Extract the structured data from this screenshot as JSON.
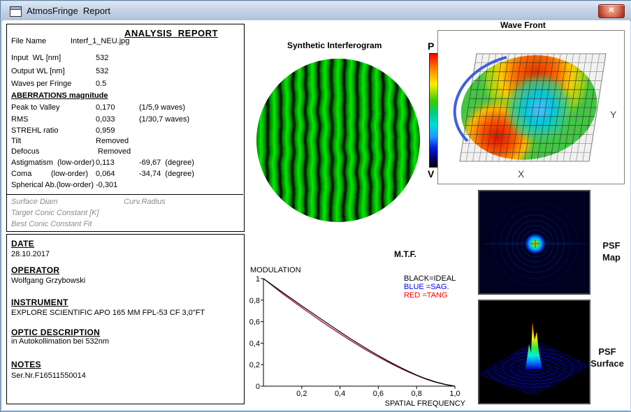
{
  "window": {
    "title": "AtmosFringe  Report",
    "close_glyph": "✕"
  },
  "report": {
    "title": "ANALYSIS  REPORT",
    "rows": [
      {
        "label": "File Name",
        "value": "Interf_1_NEU.jpg"
      },
      {
        "label": "Input  WL [nm]",
        "value": "532"
      },
      {
        "label": "Output WL [nm]",
        "value": "532"
      },
      {
        "label": "Waves per Fringe",
        "value": "0.5"
      }
    ],
    "aberrations_heading": "ABERRATIONS magnitude",
    "aberration_rows": [
      {
        "label": "Peak to Valley",
        "value": "0,170",
        "extra": "(1/5,9 waves)"
      },
      {
        "label": "RMS",
        "value": "0,033",
        "extra": "(1/30,7 waves)"
      },
      {
        "label": "STREHL ratio",
        "value": "0,959",
        "extra": ""
      },
      {
        "label": "Tilt",
        "value": "Removed",
        "extra": ""
      },
      {
        "label": "Defocus",
        "value": " Removed",
        "extra": ""
      },
      {
        "label": "Astigmatism  (low-order)",
        "value": "0,113",
        "extra": "-69,67  (degree)"
      },
      {
        "label": "Coma         (low-order)",
        "value": "0,064",
        "extra": "-34,74  (degree)"
      },
      {
        "label": "Spherical Ab.(low-order)",
        "value": "-0,301",
        "extra": ""
      }
    ],
    "conic": {
      "line1a": "Surface Diam",
      "line1b": "Curv.Radius",
      "line2": "Target Conic Constant [K]",
      "line3": "Best Conic Constant Fit"
    }
  },
  "info": {
    "sections": [
      {
        "heading": "DATE",
        "text": "28.10.2017"
      },
      {
        "heading": "OPERATOR",
        "text": "Wolfgang Grzybowski"
      },
      {
        "heading": "INSTRUMENT",
        "text": "EXPLORE SCIENTIFIC APO 165 MM FPL-53 CF 3,0\"FT"
      },
      {
        "heading": "OPTIC DESCRIPTION",
        "text": "in Autokollimation bei 532nm"
      },
      {
        "heading": "NOTES",
        "text": "Ser.Nr.F16511550014"
      }
    ]
  },
  "interferogram": {
    "title": "Synthetic Interferogram",
    "fringe_color": "#00ee00"
  },
  "wavefront": {
    "title": "Wave Front",
    "colorbar_top": "P",
    "colorbar_bottom": "V",
    "x_label": "X",
    "y_label": "Y"
  },
  "psf": {
    "map_label_line1": "PSF",
    "map_label_line2": "Map",
    "surface_label_line1": "PSF",
    "surface_label_line2": "Surface"
  },
  "mtf": {
    "legend": [
      {
        "text": "BLACK=IDEAL",
        "color": "#000000"
      },
      {
        "text": "BLUE  =SAG.",
        "color": "#0000ff"
      },
      {
        "text": "RED    =TANG",
        "color": "#ff0000"
      }
    ]
  },
  "chart_data": {
    "type": "line",
    "title": "M.T.F.",
    "xlabel": "SPATIAL FREQUENCY",
    "ylabel": "MODULATION",
    "xlim": [
      0,
      1
    ],
    "ylim": [
      0,
      1
    ],
    "grid": false,
    "legend_position": "top-right",
    "x_ticks": [
      "0,2",
      "0,4",
      "0,6",
      "0,8",
      "1,0"
    ],
    "y_ticks": [
      "1",
      "0,8",
      "0,6",
      "0,4",
      "0,2",
      "0"
    ],
    "x": [
      0,
      0.05,
      0.1,
      0.15,
      0.2,
      0.25,
      0.3,
      0.35,
      0.4,
      0.45,
      0.5,
      0.55,
      0.6,
      0.65,
      0.7,
      0.75,
      0.8,
      0.85,
      0.9,
      0.95,
      1
    ],
    "series": [
      {
        "name": "IDEAL",
        "color": "#000000",
        "values": [
          1,
          0.936,
          0.872,
          0.81,
          0.747,
          0.687,
          0.625,
          0.565,
          0.505,
          0.447,
          0.391,
          0.337,
          0.285,
          0.235,
          0.188,
          0.144,
          0.104,
          0.068,
          0.039,
          0.016,
          0
        ]
      },
      {
        "name": "SAG",
        "color": "#0000cc",
        "values": [
          1,
          0.93,
          0.86,
          0.795,
          0.73,
          0.668,
          0.605,
          0.545,
          0.487,
          0.43,
          0.375,
          0.322,
          0.272,
          0.224,
          0.179,
          0.137,
          0.099,
          0.064,
          0.036,
          0.014,
          0
        ]
      },
      {
        "name": "TANG",
        "color": "#cc0000",
        "values": [
          1,
          0.932,
          0.862,
          0.797,
          0.732,
          0.67,
          0.607,
          0.547,
          0.489,
          0.432,
          0.377,
          0.324,
          0.274,
          0.226,
          0.181,
          0.139,
          0.1,
          0.065,
          0.037,
          0.015,
          0
        ]
      }
    ]
  }
}
